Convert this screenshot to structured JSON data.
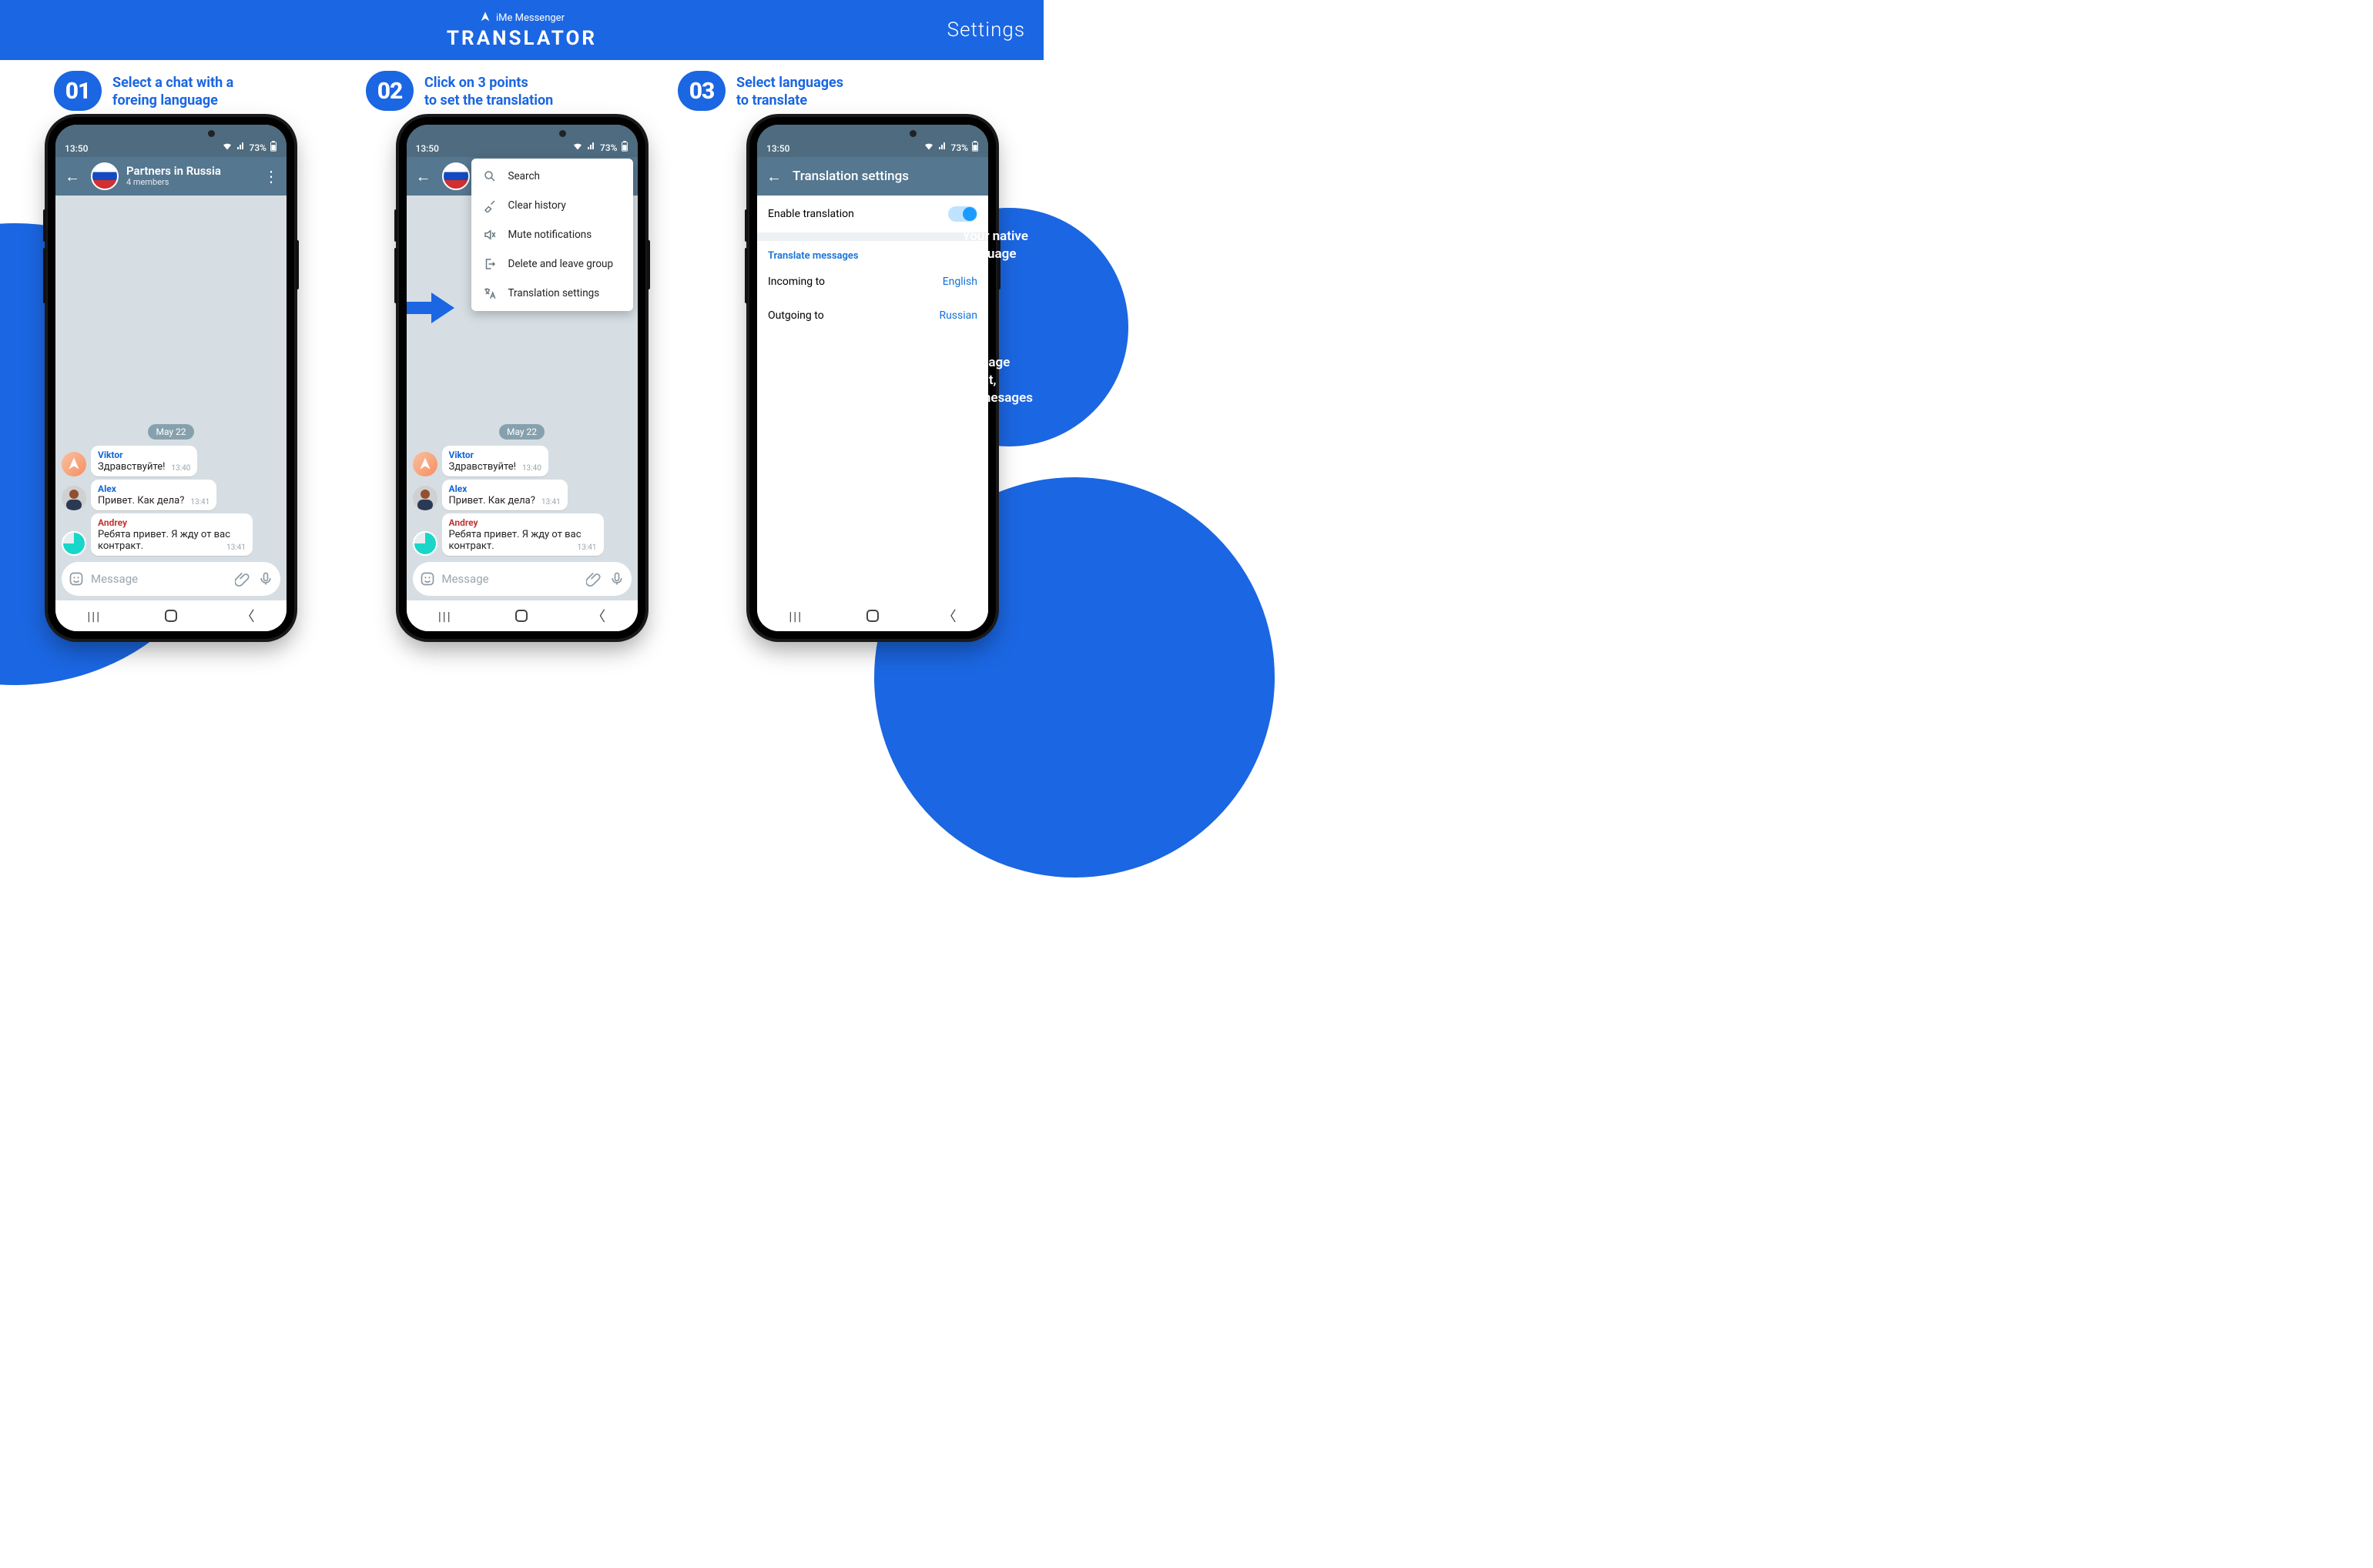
{
  "banner": {
    "brand": "iMe Messenger",
    "title": "TRANSLATOR",
    "settings": "Settings"
  },
  "steps": [
    {
      "num": "01",
      "line1": "Select a chat with a",
      "line2": "foreing language"
    },
    {
      "num": "02",
      "line1": "Click on 3 points",
      "line2": "to set the translation"
    },
    {
      "num": "03",
      "line1": "Select languages",
      "line2": "to translate"
    }
  ],
  "status": {
    "time": "13:50",
    "battery": "73%"
  },
  "chat": {
    "title": "Partners in Russia",
    "subtitle": "4 members",
    "date": "May 22",
    "messages": [
      {
        "sender": "Viktor",
        "senderClass": "viktor",
        "text": "Здравствуйте!",
        "time": "13:40"
      },
      {
        "sender": "Alex",
        "senderClass": "alex",
        "text": "Привет. Как дела?",
        "time": "13:41"
      },
      {
        "sender": "Andrey",
        "senderClass": "andrey",
        "text": "Ребята привет. Я жду от вас контракт.",
        "time": "13:41"
      }
    ],
    "placeholder": "Message"
  },
  "dropdown": [
    {
      "label": "Search"
    },
    {
      "label": "Clear history"
    },
    {
      "label": "Mute notifications"
    },
    {
      "label": "Delete and leave group"
    },
    {
      "label": "Translation settings"
    }
  ],
  "settings": {
    "title": "Translation settings",
    "enable": "Enable translation",
    "section": "Translate messages",
    "incoming_label": "Incoming to",
    "incoming_value": "English",
    "outgoing_label": "Outgoing to",
    "outgoing_value": "Russian"
  },
  "annots": {
    "native1": "Your native",
    "native2": "language",
    "chat1": "The language",
    "chat2": "of the chat,",
    "chat3": "for your mesages"
  }
}
